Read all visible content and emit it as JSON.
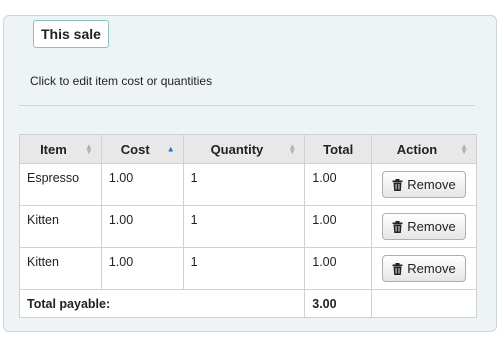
{
  "panel": {
    "legend": "This sale",
    "hint": "Click to edit item cost or quantities"
  },
  "table": {
    "headers": [
      {
        "label": "Item",
        "sort": "none"
      },
      {
        "label": "Cost",
        "sort": "asc"
      },
      {
        "label": "Quantity",
        "sort": "none"
      },
      {
        "label": "Total",
        "sort": "hidden"
      },
      {
        "label": "Action",
        "sort": "none"
      }
    ],
    "rows": [
      {
        "item": "Espresso",
        "cost": "1.00",
        "quantity": "1",
        "total": "1.00",
        "action": "Remove"
      },
      {
        "item": "Kitten",
        "cost": "1.00",
        "quantity": "1",
        "total": "1.00",
        "action": "Remove"
      },
      {
        "item": "Kitten",
        "cost": "1.00",
        "quantity": "1",
        "total": "1.00",
        "action": "Remove"
      }
    ],
    "footer": {
      "label": "Total payable:",
      "total": "3.00"
    }
  },
  "icons": {
    "remove": "trash-icon",
    "sort": "sort-icon"
  },
  "colors": {
    "panel_bg": "#eef4f6",
    "legend_border": "#8cc2bd",
    "sort_active": "#1a73c7"
  }
}
